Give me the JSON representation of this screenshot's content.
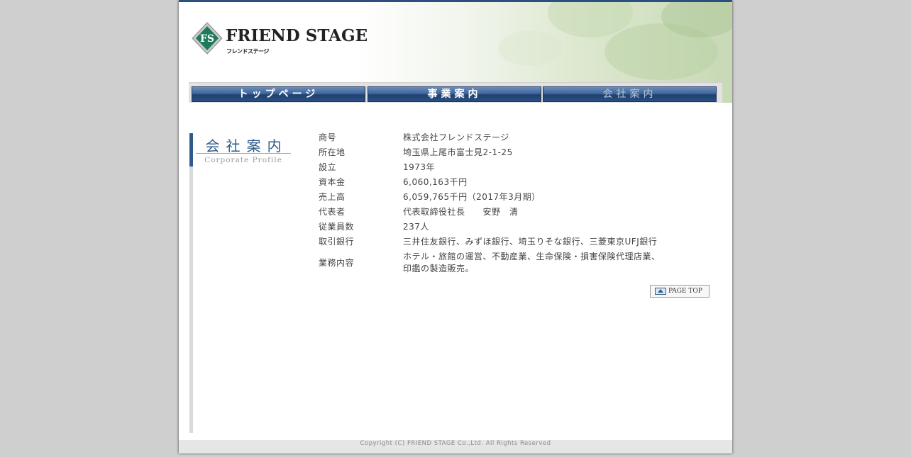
{
  "logo": {
    "main": "FRIEND STAGE",
    "sub": "フレンドステージ",
    "mark_letters": "FS"
  },
  "nav": [
    {
      "label": "トップページ",
      "current": false
    },
    {
      "label": "事業案内",
      "current": false
    },
    {
      "label": "会社案内",
      "current": true
    }
  ],
  "section": {
    "title": "会社案内",
    "subtitle": "Corporate Profile"
  },
  "profile": [
    {
      "key": "商号",
      "value": "株式会社フレンドステージ"
    },
    {
      "key": "所在地",
      "value": "埼玉県上尾市富士見2-1-25"
    },
    {
      "key": "設立",
      "value": "1973年"
    },
    {
      "key": "資本金",
      "value": "6,060,163千円"
    },
    {
      "key": "売上高",
      "value": "6,059,765千円（2017年3月期）"
    },
    {
      "key": "代表者",
      "value": "代表取締役社長　　安野　清"
    },
    {
      "key": "従業員数",
      "value": "237人"
    },
    {
      "key": "取引銀行",
      "value": "三井住友銀行、みずほ銀行、埼玉りそな銀行、三菱東京UFJ銀行"
    },
    {
      "key": "業務内容",
      "value": "ホテル・旅館の運営、不動産業、生命保険・損害保険代理店業、",
      "value2": "印鑑の製造販売。"
    }
  ],
  "page_top": {
    "label": "PAGE TOP"
  },
  "footer": {
    "copyright": "Copyright (C) FRIEND STAGE Co.,Ltd. All Rights Reserved"
  },
  "colors": {
    "accent": "#2e5a8c",
    "nav_dark": "#1e416f",
    "logo_green": "#1e7a5a"
  }
}
